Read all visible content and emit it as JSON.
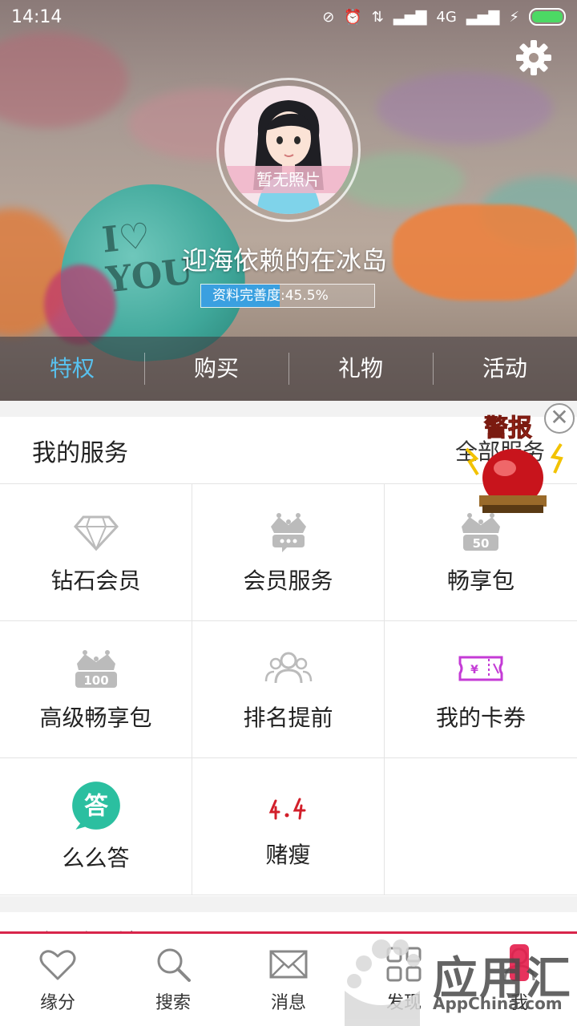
{
  "status_bar": {
    "time": "14:14",
    "network": "4G"
  },
  "profile": {
    "no_photo": "暂无照片",
    "username": "迎海依赖的在冰岛",
    "completeness_label": "资料完善度:45.5%",
    "completeness": 0.455
  },
  "hero_heart": {
    "line1": "I♡",
    "line2": "YOU"
  },
  "tabs": [
    {
      "label": "特权",
      "active": true
    },
    {
      "label": "购买"
    },
    {
      "label": "礼物"
    },
    {
      "label": "活动"
    }
  ],
  "services": {
    "title": "我的服务",
    "all_label": "全部服务",
    "items": [
      {
        "label": "钻石会员",
        "icon": "diamond-icon"
      },
      {
        "label": "会员服务",
        "icon": "crown-chat-icon"
      },
      {
        "label": "畅享包",
        "icon": "crown-50-icon",
        "badge": "50"
      },
      {
        "label": "高级畅享包",
        "icon": "crown-100-icon",
        "badge": "100"
      },
      {
        "label": "排名提前",
        "icon": "people-icon"
      },
      {
        "label": "我的卡券",
        "icon": "ticket-icon",
        "badge": "¥"
      },
      {
        "label": "么么答",
        "icon": "answer-icon",
        "badge": "答"
      },
      {
        "label": "赌瘦",
        "icon": "slim-icon"
      }
    ]
  },
  "alarm_ad": {
    "label": "警报"
  },
  "club": {
    "title": "会员俱乐部"
  },
  "bottom_nav": [
    {
      "label": "缘分",
      "icon": "heart-icon"
    },
    {
      "label": "搜索",
      "icon": "search-icon"
    },
    {
      "label": "消息",
      "icon": "mail-icon"
    },
    {
      "label": "发现",
      "icon": "grid-icon"
    },
    {
      "label": "我",
      "icon": "person-icon"
    }
  ],
  "watermark": {
    "brand": "应用汇",
    "sub": "AppChina.com"
  },
  "colors": {
    "accent": "#58c1ee",
    "nav_border": "#d8254a",
    "progress": "#3aa0e0"
  }
}
